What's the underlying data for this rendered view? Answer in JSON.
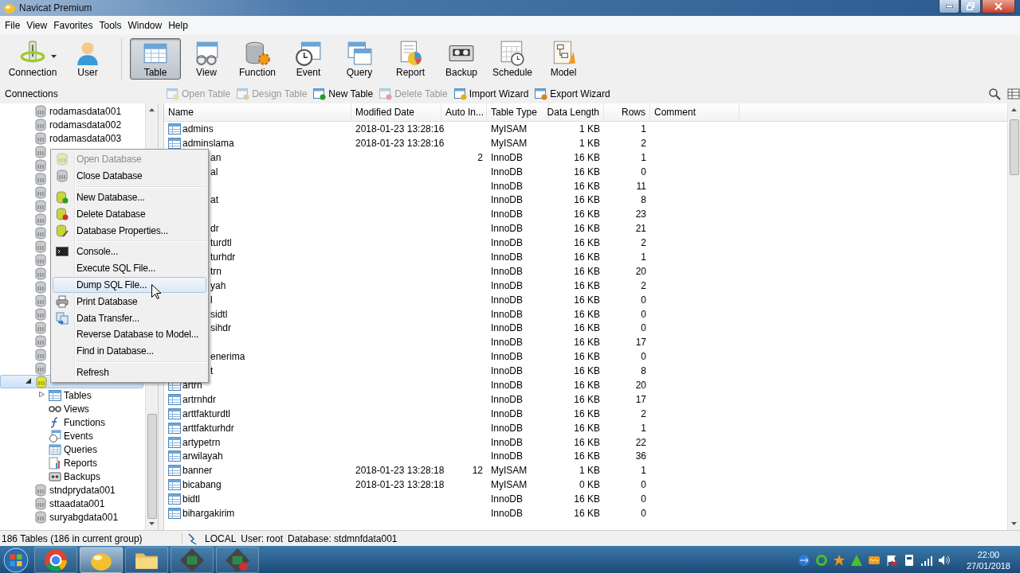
{
  "window": {
    "title": "Navicat Premium"
  },
  "menu_bar": [
    "File",
    "View",
    "Favorites",
    "Tools",
    "Window",
    "Help"
  ],
  "toolbar": [
    {
      "label": "Connection",
      "selected": false,
      "dropdown": true
    },
    {
      "label": "User",
      "selected": false
    },
    {
      "label": "Table",
      "selected": true
    },
    {
      "label": "View",
      "selected": false
    },
    {
      "label": "Function",
      "selected": false
    },
    {
      "label": "Event",
      "selected": false
    },
    {
      "label": "Query",
      "selected": false
    },
    {
      "label": "Report",
      "selected": false
    },
    {
      "label": "Backup",
      "selected": false
    },
    {
      "label": "Schedule",
      "selected": false
    },
    {
      "label": "Model",
      "selected": false
    }
  ],
  "connections_label": "Connections",
  "object_toolbar": [
    {
      "label": "Open Table",
      "disabled": true
    },
    {
      "label": "Design Table",
      "disabled": true
    },
    {
      "label": "New Table",
      "disabled": false
    },
    {
      "label": "Delete Table",
      "disabled": true
    },
    {
      "label": "Import Wizard",
      "disabled": false
    },
    {
      "label": "Export Wizard",
      "disabled": false
    }
  ],
  "tree": [
    {
      "name": "rodamasdata001",
      "selected": false
    },
    {
      "name": "rodamasdata002",
      "selected": false
    },
    {
      "name": "rodamasdata003",
      "selected": false
    },
    {
      "selected": false
    },
    {
      "selected": false
    },
    {
      "selected": false
    },
    {
      "selected": false
    },
    {
      "selected": false
    },
    {
      "selected": false
    },
    {
      "selected": false
    },
    {
      "selected": false
    },
    {
      "selected": false
    },
    {
      "selected": false
    },
    {
      "selected": false
    },
    {
      "selected": false
    },
    {
      "selected": false
    },
    {
      "selected": false
    },
    {
      "selected": false
    },
    {
      "selected": false
    },
    {
      "selected": false
    },
    {
      "selected": true,
      "expanded": true,
      "children": [
        {
          "name": "Tables",
          "kind": "tables",
          "expanded": false,
          "selected": false
        },
        {
          "name": "Views",
          "kind": "views",
          "selected": false
        },
        {
          "name": "Functions",
          "kind": "functions",
          "selected": false
        },
        {
          "name": "Events",
          "kind": "events",
          "selected": false
        },
        {
          "name": "Queries",
          "kind": "queries",
          "selected": false
        },
        {
          "name": "Reports",
          "kind": "reports",
          "selected": false
        },
        {
          "name": "Backups",
          "kind": "backups",
          "selected": false
        }
      ]
    },
    {
      "name": "stndprydata001",
      "selected": false
    },
    {
      "name": "sttaadata001",
      "selected": false
    },
    {
      "name": "suryabgdata001",
      "selected": false
    }
  ],
  "table": {
    "columns": [
      "Name",
      "Modified Date",
      "Auto In...",
      "Table Type",
      "Data Length",
      "Rows",
      "Comment"
    ],
    "rows": [
      {
        "kind": "full",
        "name": "admins",
        "modified": "2018-01-23 13:28:16",
        "type": "MyISAM",
        "length": "1 KB",
        "rows": "1"
      },
      {
        "kind": "full",
        "name": "adminslama",
        "modified": "2018-01-23 13:28:16",
        "type": "MyISAM",
        "length": "1 KB",
        "rows": "2"
      },
      {
        "kind": "partial",
        "name": "an",
        "auto": "2",
        "type": "InnoDB",
        "length": "16 KB",
        "rows": "1"
      },
      {
        "kind": "partial",
        "name": "al",
        "type": "InnoDB",
        "length": "16 KB",
        "rows": "0"
      },
      {
        "kind": "partial",
        "type": "InnoDB",
        "length": "16 KB",
        "rows": "11"
      },
      {
        "kind": "partial",
        "name": "at",
        "type": "InnoDB",
        "length": "16 KB",
        "rows": "8"
      },
      {
        "kind": "partial",
        "type": "InnoDB",
        "length": "16 KB",
        "rows": "23"
      },
      {
        "kind": "partial",
        "name": "dr",
        "type": "InnoDB",
        "length": "16 KB",
        "rows": "21"
      },
      {
        "kind": "partial",
        "name": "turdtl",
        "type": "InnoDB",
        "length": "16 KB",
        "rows": "2"
      },
      {
        "kind": "partial",
        "name": "turhdr",
        "type": "InnoDB",
        "length": "16 KB",
        "rows": "1"
      },
      {
        "kind": "partial",
        "name": "trn",
        "type": "InnoDB",
        "length": "16 KB",
        "rows": "20"
      },
      {
        "kind": "partial",
        "name": "yah",
        "type": "InnoDB",
        "length": "16 KB",
        "rows": "2"
      },
      {
        "kind": "partial",
        "name": "l",
        "type": "InnoDB",
        "length": "16 KB",
        "rows": "0"
      },
      {
        "kind": "partial",
        "name": "sidtl",
        "type": "InnoDB",
        "length": "16 KB",
        "rows": "0"
      },
      {
        "kind": "partial",
        "name": "sihdr",
        "type": "InnoDB",
        "length": "16 KB",
        "rows": "0"
      },
      {
        "kind": "partial",
        "type": "InnoDB",
        "length": "16 KB",
        "rows": "17"
      },
      {
        "kind": "partial",
        "name": "enerima",
        "type": "InnoDB",
        "length": "16 KB",
        "rows": "0"
      },
      {
        "kind": "partial",
        "name": "t",
        "type": "InnoDB",
        "length": "16 KB",
        "rows": "8"
      },
      {
        "kind": "full",
        "name": "artrn",
        "type": "InnoDB",
        "length": "16 KB",
        "rows": "20"
      },
      {
        "kind": "full",
        "name": "artrnhdr",
        "type": "InnoDB",
        "length": "16 KB",
        "rows": "17"
      },
      {
        "kind": "full",
        "name": "arttfakturdtl",
        "type": "InnoDB",
        "length": "16 KB",
        "rows": "2"
      },
      {
        "kind": "full",
        "name": "arttfakturhdr",
        "type": "InnoDB",
        "length": "16 KB",
        "rows": "1"
      },
      {
        "kind": "full",
        "name": "artypetrn",
        "type": "InnoDB",
        "length": "16 KB",
        "rows": "22"
      },
      {
        "kind": "full",
        "name": "arwilayah",
        "type": "InnoDB",
        "length": "16 KB",
        "rows": "36"
      },
      {
        "kind": "full",
        "name": "banner",
        "modified": "2018-01-23 13:28:18",
        "auto": "12",
        "type": "MyISAM",
        "length": "1 KB",
        "rows": "1"
      },
      {
        "kind": "full",
        "name": "bicabang",
        "modified": "2018-01-23 13:28:18",
        "type": "MyISAM",
        "length": "0 KB",
        "rows": "0"
      },
      {
        "kind": "full",
        "name": "bidtl",
        "type": "InnoDB",
        "length": "16 KB",
        "rows": "0"
      },
      {
        "kind": "full",
        "name": "bihargakirim",
        "type": "InnoDB",
        "length": "16 KB",
        "rows": "0"
      }
    ]
  },
  "context_menu": [
    {
      "kind": "item",
      "label": "Open Database",
      "disabled": true,
      "selected": false
    },
    {
      "kind": "item",
      "label": "Close Database",
      "disabled": false,
      "selected": false
    },
    {
      "kind": "separator"
    },
    {
      "kind": "item",
      "label": "New Database...",
      "disabled": false,
      "selected": false
    },
    {
      "kind": "item",
      "label": "Delete Database",
      "disabled": false,
      "selected": false
    },
    {
      "kind": "item",
      "label": "Database Properties...",
      "disabled": false,
      "selected": false
    },
    {
      "kind": "separator"
    },
    {
      "kind": "item",
      "label": "Console...",
      "disabled": false,
      "selected": false
    },
    {
      "kind": "item",
      "label": "Execute SQL File...",
      "disabled": false,
      "selected": false
    },
    {
      "kind": "item",
      "label": "Dump SQL File...",
      "disabled": false,
      "selected": true
    },
    {
      "kind": "item",
      "label": "Print Database",
      "disabled": false,
      "selected": false
    },
    {
      "kind": "item",
      "label": "Data Transfer...",
      "disabled": false,
      "selected": false
    },
    {
      "kind": "item",
      "label": "Reverse Database to Model...",
      "disabled": false,
      "selected": false
    },
    {
      "kind": "item",
      "label": "Find in Database...",
      "disabled": false,
      "selected": false
    },
    {
      "kind": "separator"
    },
    {
      "kind": "item",
      "label": "Refresh",
      "disabled": false,
      "selected": false
    }
  ],
  "status_bar": {
    "count": "186 Tables (186 in current group)",
    "connection": "LOCAL",
    "user": "User: root",
    "database": "Database: stdmnfdata001"
  },
  "taskbar": {
    "apps": [
      {
        "selected": false
      },
      {
        "selected": true
      },
      {
        "selected": false
      },
      {
        "selected": false
      },
      {
        "selected": false
      }
    ],
    "time": "22:00",
    "date": "27/01/2018"
  }
}
